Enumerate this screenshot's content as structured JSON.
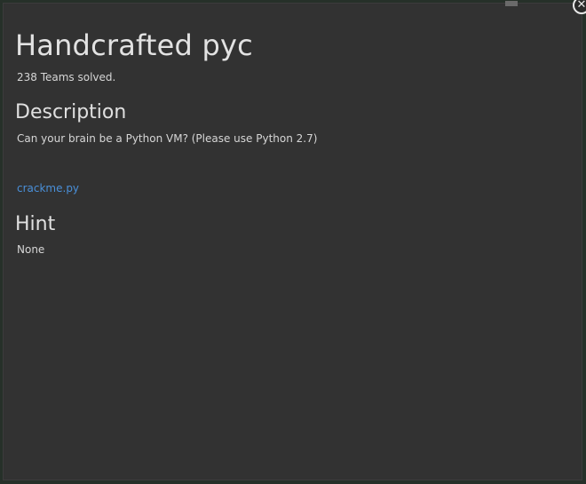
{
  "challenge": {
    "title": "Handcrafted pyc",
    "solved_text": "238 Teams solved.",
    "description_heading": "Description",
    "description_text": "Can your brain be a Python VM? (Please use Python 2.7)",
    "file_link": "crackme.py",
    "hint_heading": "Hint",
    "hint_text": "None"
  },
  "controls": {
    "close_glyph": "✕"
  },
  "colors": {
    "modal_background": "#323232",
    "link": "#4a90d9"
  }
}
